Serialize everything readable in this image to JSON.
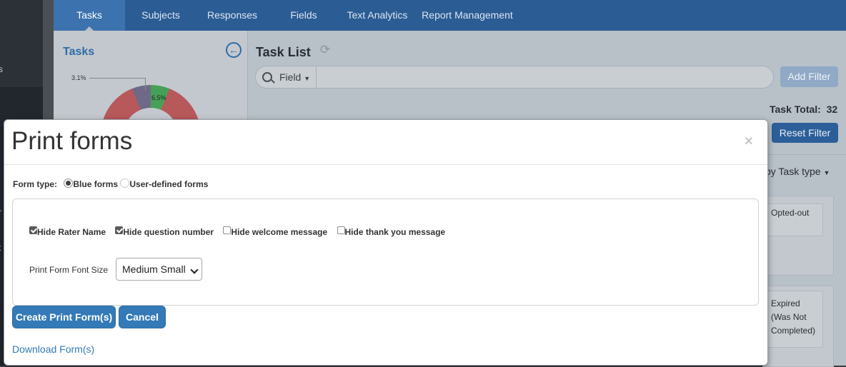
{
  "nav": {
    "tabs": [
      {
        "label": "Tasks"
      },
      {
        "label": "Subjects"
      },
      {
        "label": "Responses"
      },
      {
        "label": "Fields"
      },
      {
        "label": "Text Analytics"
      },
      {
        "label": "Report Management"
      }
    ],
    "active_tab": "Tasks"
  },
  "left_panel": {
    "title": "Tasks",
    "chart_labels": [
      "3.1%",
      "6.5%"
    ]
  },
  "task_list": {
    "title": "Task List",
    "filter_field_label": "Field",
    "add_filter_label": "Add Filter",
    "total_label": "Task Total:",
    "total_value": "32",
    "reset_filter_label": "Reset Filter",
    "group_by_label": "by Task type",
    "cards": [
      {
        "label": "Opted-out"
      },
      {
        "label": "Expired"
      },
      {
        "label": "(Was Not"
      },
      {
        "label": "Completed)"
      }
    ]
  },
  "modal": {
    "title": "Print forms",
    "close_label": "×",
    "form_type_label": "Form type:",
    "form_type_options": [
      {
        "label": "Blue forms",
        "selected": true
      },
      {
        "label": "User-defined forms",
        "selected": false
      }
    ],
    "checkboxes": [
      {
        "label": "Hide Rater Name",
        "checked": true
      },
      {
        "label": "Hide question number",
        "checked": true
      },
      {
        "label": "Hide welcome message",
        "checked": false
      },
      {
        "label": "Hide thank you message",
        "checked": false
      }
    ],
    "font_size_label": "Print Form Font Size",
    "font_size_value": "Medium Small",
    "create_button_label": "Create Print Form(s)",
    "cancel_button_label": "Cancel",
    "download_link_label": "Download Form(s)"
  },
  "colors": {
    "nav_bg": "#2b5c94",
    "primary": "#337ab7",
    "link": "#337ab7",
    "chart_red": "#b7585a",
    "chart_green": "#47a057",
    "chart_purple": "#6f6989"
  },
  "chart_data": {
    "type": "pie",
    "labels": [
      "3.1%",
      "6.5%"
    ],
    "values": [
      3.1,
      6.5
    ]
  }
}
